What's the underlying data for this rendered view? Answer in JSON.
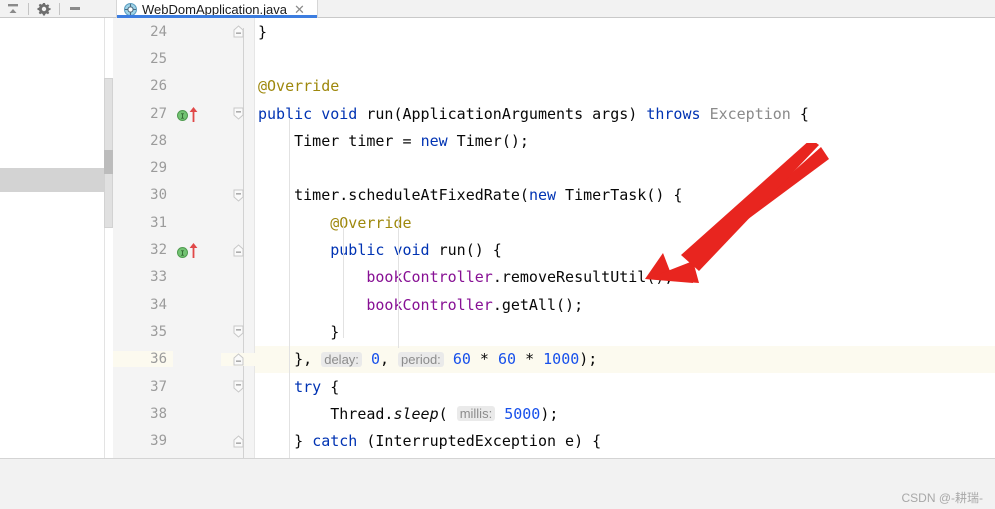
{
  "window": {
    "toolbar": {
      "icons": [
        {
          "name": "collapse-all-icon",
          "label": "Collapse All"
        },
        {
          "name": "gear-icon",
          "label": "Settings"
        },
        {
          "name": "minimize-icon",
          "label": "Hide"
        }
      ]
    }
  },
  "tab": {
    "label": "WebDomApplication.java",
    "icon": "java-class-icon",
    "close_label": "✕",
    "active": true,
    "accent_color": "#3c7de0"
  },
  "editor": {
    "first_line": 24,
    "highlight_line": 36,
    "colors": {
      "keyword": "#0033b3",
      "annotation": "#9e880d",
      "field": "#871094",
      "number": "#1750eb",
      "type": "#8a8a8a",
      "text": "#080808",
      "hint_text": "#8c8c8c",
      "hint_bg": "#eaeaea",
      "caret_row_bg": "#fcfaef",
      "gutter_bg": "#f4f4f4",
      "lineno": "#9b9b9b"
    },
    "lines": [
      {
        "no": "24",
        "fold": "up",
        "markers": [],
        "indent": 0,
        "tokens": [
          {
            "t": "}",
            "c": "plain"
          }
        ]
      },
      {
        "no": "25",
        "fold": "",
        "markers": [],
        "indent": 0,
        "tokens": []
      },
      {
        "no": "26",
        "fold": "",
        "markers": [],
        "indent": 0,
        "tokens": [
          {
            "t": "@Override",
            "c": "anno"
          }
        ]
      },
      {
        "no": "27",
        "fold": "down",
        "markers": [
          "impl",
          "override"
        ],
        "indent": 0,
        "tokens": [
          {
            "t": "public",
            "c": "kw"
          },
          {
            "t": " ",
            "c": "plain"
          },
          {
            "t": "void",
            "c": "kw"
          },
          {
            "t": " ",
            "c": "plain"
          },
          {
            "t": "run",
            "c": "plain"
          },
          {
            "t": "(ApplicationArguments args) ",
            "c": "plain"
          },
          {
            "t": "throws",
            "c": "kw"
          },
          {
            "t": " ",
            "c": "plain"
          },
          {
            "t": "Exception",
            "c": "typ"
          },
          {
            "t": " {",
            "c": "plain"
          }
        ]
      },
      {
        "no": "28",
        "fold": "",
        "markers": [],
        "indent": 1,
        "tokens": [
          {
            "t": "    Timer timer = ",
            "c": "plain"
          },
          {
            "t": "new",
            "c": "kw"
          },
          {
            "t": " Timer();",
            "c": "plain"
          }
        ]
      },
      {
        "no": "29",
        "fold": "",
        "markers": [],
        "indent": 1,
        "tokens": []
      },
      {
        "no": "30",
        "fold": "down",
        "markers": [],
        "indent": 1,
        "tokens": [
          {
            "t": "    timer.scheduleAtFixedRate(",
            "c": "plain"
          },
          {
            "t": "new",
            "c": "kw"
          },
          {
            "t": " TimerTask() {",
            "c": "plain"
          }
        ]
      },
      {
        "no": "31",
        "fold": "",
        "markers": [],
        "indent": 2,
        "tokens": [
          {
            "t": "        ",
            "c": "plain"
          },
          {
            "t": "@Override",
            "c": "anno"
          }
        ]
      },
      {
        "no": "32",
        "fold": "up",
        "markers": [
          "impl",
          "override"
        ],
        "indent": 2,
        "tokens": [
          {
            "t": "        ",
            "c": "plain"
          },
          {
            "t": "public",
            "c": "kw"
          },
          {
            "t": " ",
            "c": "plain"
          },
          {
            "t": "void",
            "c": "kw"
          },
          {
            "t": " ",
            "c": "plain"
          },
          {
            "t": "run",
            "c": "plain"
          },
          {
            "t": "() {",
            "c": "plain"
          }
        ]
      },
      {
        "no": "33",
        "fold": "",
        "markers": [],
        "indent": 3,
        "tokens": [
          {
            "t": "            ",
            "c": "plain"
          },
          {
            "t": "bookController",
            "c": "fld"
          },
          {
            "t": ".removeResultUtil();",
            "c": "plain"
          }
        ]
      },
      {
        "no": "34",
        "fold": "",
        "markers": [],
        "indent": 3,
        "tokens": [
          {
            "t": "            ",
            "c": "plain"
          },
          {
            "t": "bookController",
            "c": "fld"
          },
          {
            "t": ".getAll();",
            "c": "plain"
          }
        ]
      },
      {
        "no": "35",
        "fold": "down",
        "markers": [],
        "indent": 2,
        "tokens": [
          {
            "t": "        }",
            "c": "plain"
          }
        ]
      },
      {
        "no": "36",
        "fold": "up",
        "markers": [],
        "indent": 1,
        "tokens": [
          {
            "t": "    }, ",
            "c": "plain"
          },
          {
            "t": "delay:",
            "c": "hint"
          },
          {
            "t": " ",
            "c": "plain"
          },
          {
            "t": "0",
            "c": "num"
          },
          {
            "t": ", ",
            "c": "plain"
          },
          {
            "t": "period:",
            "c": "hint"
          },
          {
            "t": " ",
            "c": "plain"
          },
          {
            "t": "60",
            "c": "num"
          },
          {
            "t": " * ",
            "c": "plain"
          },
          {
            "t": "60",
            "c": "num"
          },
          {
            "t": " * ",
            "c": "plain"
          },
          {
            "t": "1000",
            "c": "num"
          },
          {
            "t": ");",
            "c": "plain"
          }
        ]
      },
      {
        "no": "37",
        "fold": "down",
        "markers": [],
        "indent": 1,
        "tokens": [
          {
            "t": "    ",
            "c": "plain"
          },
          {
            "t": "try",
            "c": "kw"
          },
          {
            "t": " {",
            "c": "plain"
          }
        ]
      },
      {
        "no": "38",
        "fold": "",
        "markers": [],
        "indent": 2,
        "tokens": [
          {
            "t": "        Thread.",
            "c": "plain"
          },
          {
            "t": "sleep",
            "c": "stat"
          },
          {
            "t": "( ",
            "c": "plain"
          },
          {
            "t": "millis:",
            "c": "hint"
          },
          {
            "t": " ",
            "c": "plain"
          },
          {
            "t": "5000",
            "c": "num"
          },
          {
            "t": ");",
            "c": "plain"
          }
        ]
      },
      {
        "no": "39",
        "fold": "up",
        "markers": [],
        "indent": 1,
        "tokens": [
          {
            "t": "    } ",
            "c": "plain"
          },
          {
            "t": "catch",
            "c": "kw"
          },
          {
            "t": " (InterruptedException e) {",
            "c": "plain"
          }
        ]
      }
    ]
  },
  "annotation": {
    "shape": "red-arrow",
    "color": "#e8251f",
    "points_at": "line-32-run-method"
  },
  "watermark": {
    "text": "CSDN @-耕瑞-"
  }
}
